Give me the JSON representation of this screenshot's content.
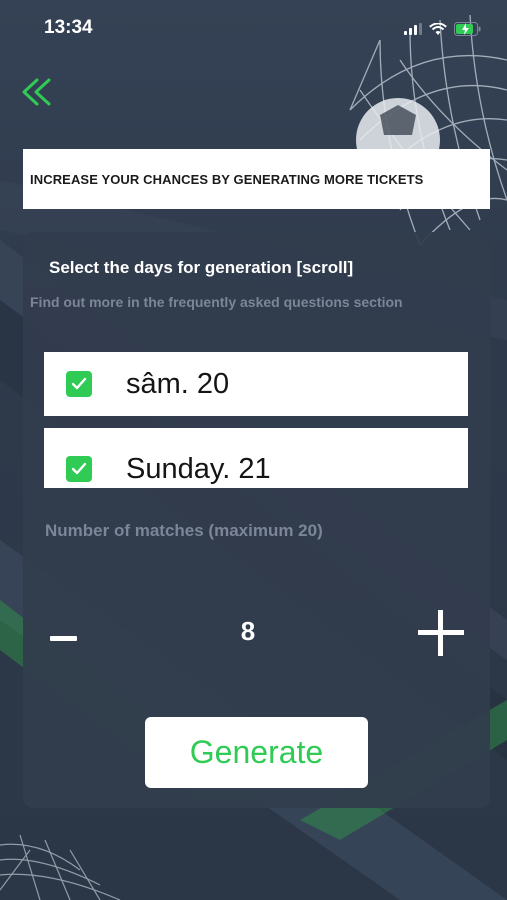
{
  "status_bar": {
    "time": "13:34",
    "icons": [
      "signal-icon",
      "wifi-icon",
      "battery-charging-icon"
    ]
  },
  "nav": {
    "back_icon": "double-chevron-left-icon"
  },
  "banner": {
    "text": "INCREASE YOUR CHANCES BY GENERATING MORE TICKETS"
  },
  "panel": {
    "title": "Select the days for generation [scroll]",
    "subtitle": "Find out more in the frequently asked questions section",
    "days": [
      {
        "label": "sâm. 20",
        "checked": true
      },
      {
        "label": "Sunday. 21",
        "checked": true
      }
    ],
    "matches_label": "Number of matches (maximum 20)",
    "match_count": "8",
    "generate_label": "Generate"
  },
  "colors": {
    "accent": "#2fcb55",
    "background": "#2f3b4d",
    "panel": "#313c4d",
    "muted_text": "#7b8698"
  }
}
